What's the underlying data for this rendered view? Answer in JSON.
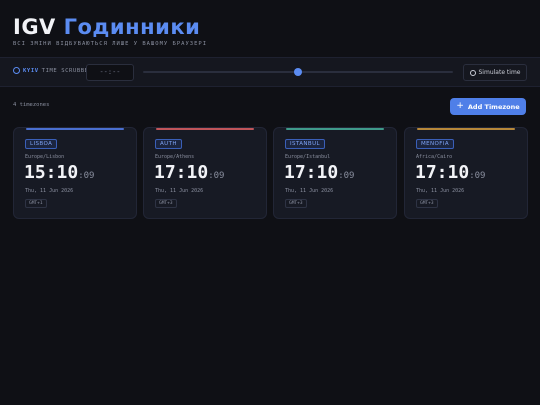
{
  "header": {
    "brand": "IGV",
    "title": "Годинники",
    "subtitle": "ВСІ ЗМІНИ ВІДБУВАЮТЬСЯ ЛИШЕ У ВАШОМУ БРАУЗЕРІ"
  },
  "scrubber": {
    "city": "KYIV",
    "label": "TIME SCRUBBER",
    "time_placeholder": "--:--",
    "position": 0.5,
    "simulate_label": "Simulate time"
  },
  "toolbar": {
    "count": "4 timezones",
    "add_label": "Add Timezone"
  },
  "cards": [
    {
      "name": "LISBOA",
      "zone": "Europe/Lisbon",
      "hm": "15:10",
      "sec": ":09",
      "date": "Thu, 11 Jun 2026",
      "offset": "GMT+1",
      "color": "#4a6fd0"
    },
    {
      "name": "AUTH",
      "zone": "Europe/Athens",
      "hm": "17:10",
      "sec": ":09",
      "date": "Thu, 11 Jun 2026",
      "offset": "GMT+3",
      "color": "#c0555a"
    },
    {
      "name": "ISTANBUL",
      "zone": "Europe/Istanbul",
      "hm": "17:10",
      "sec": ":09",
      "date": "Thu, 11 Jun 2026",
      "offset": "GMT+3",
      "color": "#3f9a8a"
    },
    {
      "name": "MENOFIA",
      "zone": "Africa/Cairo",
      "hm": "17:10",
      "sec": ":09",
      "date": "Thu, 11 Jun 2026",
      "offset": "GMT+3",
      "color": "#b7883a"
    }
  ]
}
